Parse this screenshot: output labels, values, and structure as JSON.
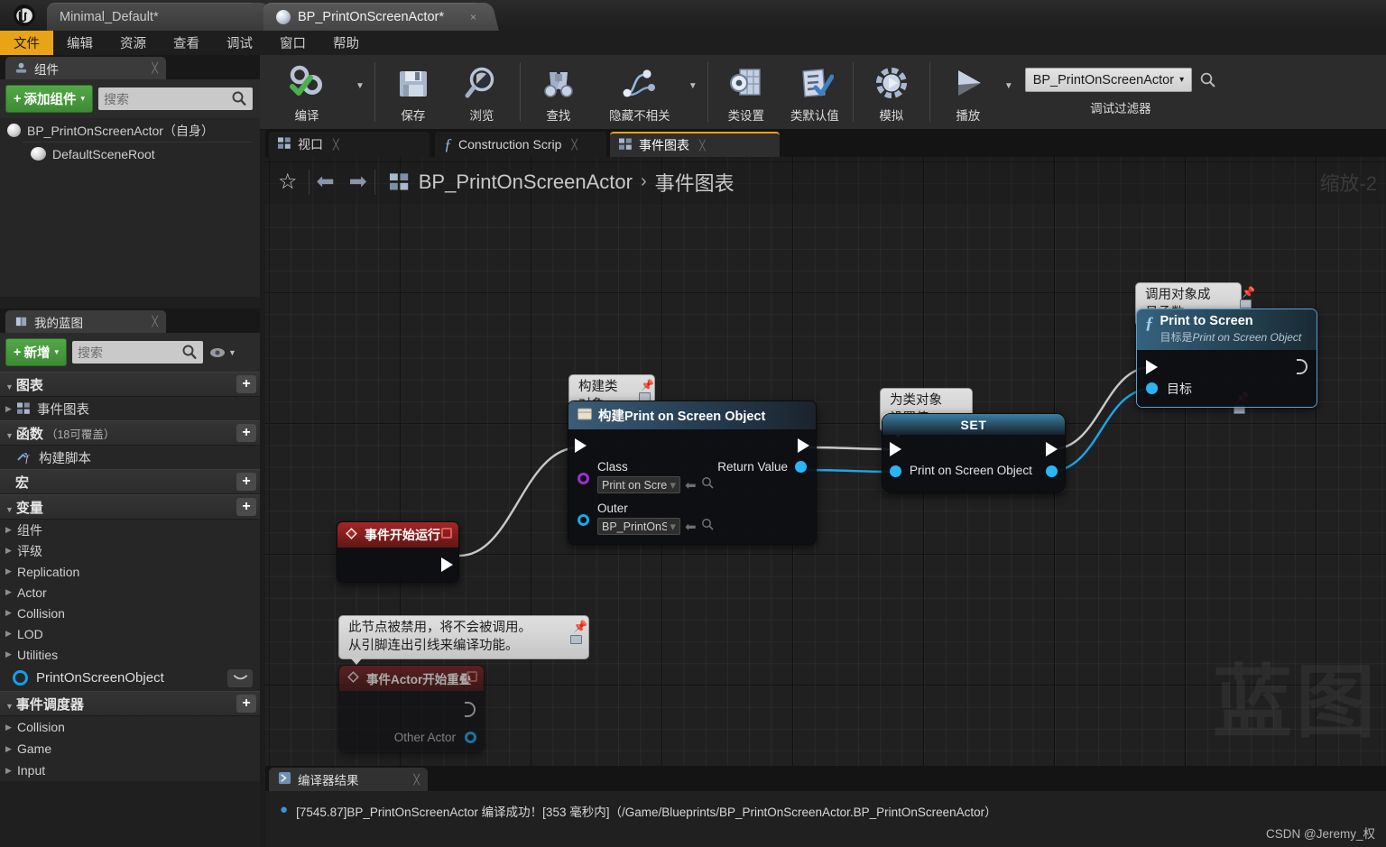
{
  "window": {
    "logo_icon": "unreal-engine-logo",
    "tabs": [
      {
        "label": "Minimal_Default*",
        "active": false,
        "icon": "none"
      },
      {
        "label": "BP_PrintOnScreenActor*",
        "active": true,
        "icon": "blueprint-sphere-icon"
      }
    ],
    "close_glyph": "×"
  },
  "menubar": {
    "items": [
      "文件",
      "编辑",
      "资源",
      "查看",
      "调试",
      "窗口",
      "帮助"
    ]
  },
  "toolbar": {
    "buttons": [
      {
        "label": "编译",
        "icon": "compile-gear-check-icon",
        "has_caret": true
      },
      {
        "label": "保存",
        "icon": "save-floppy-icon",
        "has_caret": false
      },
      {
        "label": "浏览",
        "icon": "browse-magnifier-icon",
        "has_caret": false
      },
      {
        "label": "查找",
        "icon": "find-binoculars-icon",
        "has_caret": false
      },
      {
        "label": "隐藏不相关",
        "icon": "hide-unrelated-nodes-icon",
        "has_caret": true
      },
      {
        "label": "类设置",
        "icon": "class-settings-icon",
        "has_caret": false
      },
      {
        "label": "类默认值",
        "icon": "class-defaults-icon",
        "has_caret": false
      },
      {
        "label": "模拟",
        "icon": "simulate-icon",
        "has_caret": false
      },
      {
        "label": "播放",
        "icon": "play-icon",
        "has_caret": true
      }
    ],
    "debug_filter": {
      "value": "BP_PrintOnScreenActor",
      "caption": "调试过滤器",
      "search_icon": "search-icon",
      "caret": "▾"
    }
  },
  "components_panel": {
    "tab_label": "组件",
    "tab_icon": "components-icon",
    "add_button": "添加组件",
    "add_caret": "▾",
    "search_placeholder": "搜索",
    "tree": [
      {
        "label": "BP_PrintOnScreenActor（自身）",
        "depth": 0,
        "icon": "actor-sphere-icon"
      },
      {
        "label": "DefaultSceneRoot",
        "depth": 1,
        "icon": "scene-root-icon"
      }
    ]
  },
  "myblueprint_panel": {
    "tab_label": "我的蓝图",
    "tab_icon": "blueprint-book-icon",
    "add_button": "新增",
    "add_caret": "▾",
    "search_placeholder": "搜索",
    "eye_icon": "visibility-eye-icon",
    "sections": [
      {
        "title": "图表",
        "subtitle": "",
        "has_plus": true,
        "items": [
          {
            "label": "事件图表",
            "icon": "event-graph-icon",
            "expandable": true
          }
        ]
      },
      {
        "title": "函数",
        "subtitle": "（18可覆盖）",
        "has_plus": true,
        "items": [
          {
            "label": "构建脚本",
            "icon": "construction-script-icon",
            "expandable": false
          }
        ]
      },
      {
        "title": "宏",
        "subtitle": "",
        "has_plus": true,
        "items": []
      },
      {
        "title": "变量",
        "subtitle": "",
        "has_plus": true,
        "categories": [
          "组件",
          "评级",
          "Replication",
          "Actor",
          "Collision",
          "LOD",
          "Utilities"
        ],
        "variable": {
          "label": "PrintOnScreenObject",
          "pin_color": "#12a0e8",
          "eye_icon": "visibility-eye-icon"
        }
      },
      {
        "title": "事件调度器",
        "subtitle": "",
        "has_plus": true,
        "categories": [
          "Collision",
          "Game",
          "Input"
        ]
      }
    ]
  },
  "graph": {
    "tabs": [
      {
        "label": "视口",
        "icon": "viewport-icon",
        "selected": false
      },
      {
        "label": "Construction Scrip",
        "icon": "function-f-icon",
        "selected": false
      },
      {
        "label": "事件图表",
        "icon": "event-graph-icon",
        "selected": true
      }
    ],
    "breadcrumb": {
      "star_icon": "favorite-star-icon",
      "back_icon": "back-arrow-icon",
      "forward_icon": "forward-arrow-icon",
      "graph_icon": "event-graph-icon",
      "root": "BP_PrintOnScreenActor",
      "separator": "›",
      "leaf": "事件图表"
    },
    "zoom_label": "缩放-2",
    "watermark": "蓝图",
    "nodes": [
      {
        "id": "event-begin-play",
        "title": "事件开始运行",
        "kind": "event",
        "icon": "event-diamond-icon",
        "badge": "delegate-pin-icon"
      },
      {
        "id": "construct-object-from-class",
        "bubble": "构建类对象",
        "title": "构建Print on Screen Object",
        "kind": "function",
        "icon": "construct-object-icon",
        "inputs": [
          {
            "label": "Class",
            "pin": "class-pin",
            "color": "#9b30d0",
            "value": "Print on Screen Ol"
          },
          {
            "label": "Outer",
            "pin": "object-pin",
            "color": "#1aa7e8",
            "value": "BP_PrintOnScreel"
          }
        ],
        "outputs": [
          {
            "label": "Return Value",
            "pin": "object-pin",
            "color": "#29b6f6"
          }
        ]
      },
      {
        "id": "set-print-on-screen-object",
        "bubble": "为类对象设置值",
        "title": "SET",
        "kind": "set",
        "inputs": [
          {
            "label": "Print on Screen Object",
            "pin": "object-pin",
            "color": "#29b6f6"
          }
        ]
      },
      {
        "id": "print-to-screen",
        "bubble": "调用对象成员函数",
        "title": "Print to Screen",
        "subtitle_prefix": "目标是",
        "subtitle_italic": "Print on Screen Object",
        "kind": "function",
        "icon": "function-f-icon",
        "inputs": [
          {
            "label": "目标",
            "pin": "object-pin",
            "color": "#29b6f6"
          }
        ]
      },
      {
        "id": "event-actor-begin-overlap",
        "bubble": "此节点被禁用，将不会被调用。\n从引脚连出引线来编译功能。",
        "title": "事件Actor开始重叠",
        "kind": "event-disabled",
        "icon": "event-diamond-icon",
        "badge": "delegate-pin-icon",
        "outputs": [
          {
            "label": "Other Actor",
            "pin": "object-pin",
            "color": "#1aa7e8"
          }
        ]
      }
    ]
  },
  "compiler_results": {
    "tab_label": "编译器结果",
    "tab_icon": "compiler-results-icon",
    "messages": [
      "[7545.87]BP_PrintOnScreenActor 编译成功！[353 毫秒内]（/Game/Blueprints/BP_PrintOnScreenActor.BP_PrintOnScreenActor）"
    ]
  },
  "watermark_credit": "CSDN @Jeremy_权",
  "colors": {
    "accent_orange": "#e8a317",
    "green_button": "#52a846",
    "exec_white": "#ffffff",
    "object_pin_blue": "#29b6f6",
    "class_pin_purple": "#9b30d0",
    "event_red": "#9d2020",
    "canvas_bg": "#202020"
  }
}
